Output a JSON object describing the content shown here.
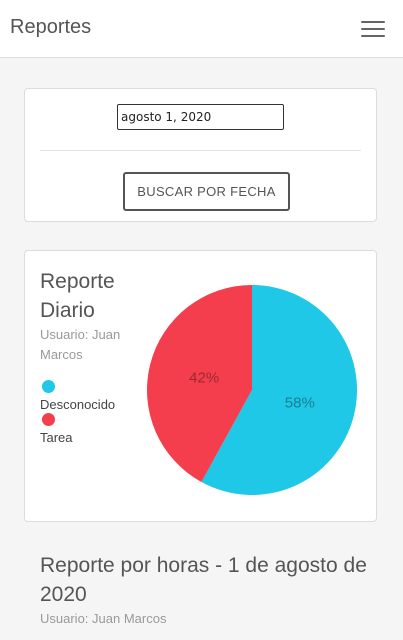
{
  "header": {
    "title": "Reportes",
    "menu_icon": "hamburger-icon"
  },
  "search": {
    "date_value": "agosto 1, 2020",
    "button_label": "BUSCAR POR FECHA"
  },
  "daily_report": {
    "title": "Reporte Diario",
    "user": "Usuario: Juan Marcos"
  },
  "chart_data": {
    "type": "pie",
    "categories": [
      "Desconocido",
      "Tarea"
    ],
    "values": [
      58,
      42
    ],
    "labels": [
      "58%",
      "42%"
    ],
    "colors": [
      "#1ec8e6",
      "#f53e4d"
    ],
    "legend_position": "left"
  },
  "hourly_report": {
    "title": "Reporte por horas - 1 de agosto de 2020",
    "user": "Usuario: Juan Marcos"
  }
}
